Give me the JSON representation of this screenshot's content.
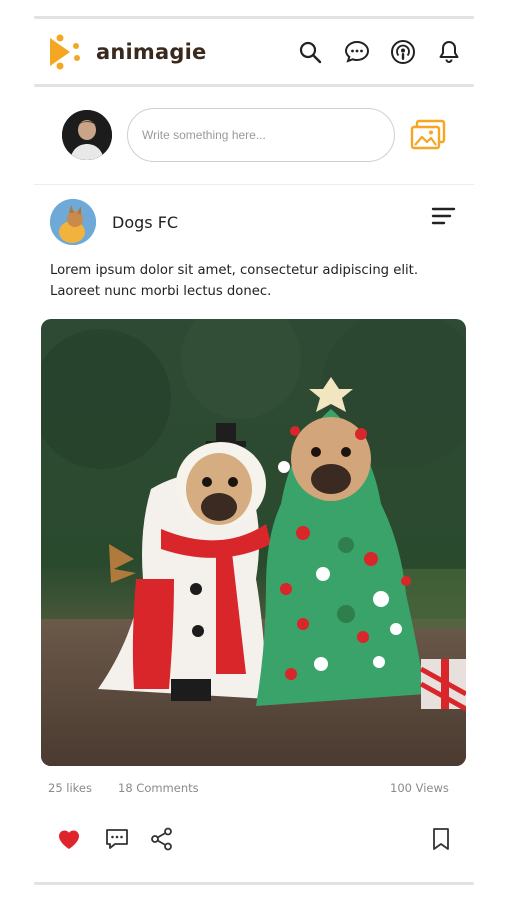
{
  "app": {
    "name": "animagie",
    "brand_color": "#f5a623"
  },
  "header": {
    "icons": [
      "search-icon",
      "chat-icon",
      "podcast-icon",
      "bell-icon"
    ]
  },
  "composer": {
    "placeholder": "Write something here..."
  },
  "post": {
    "author": "Dogs FC",
    "text_line1": "Lorem ipsum dolor sit amet, consectetur adipiscing elit.",
    "text_line2": "Laoreet nunc morbi lectus donec.",
    "likes": "25 likes",
    "comments": "18 Comments",
    "views": "100 Views",
    "liked": true,
    "like_color": "#e0242e"
  }
}
